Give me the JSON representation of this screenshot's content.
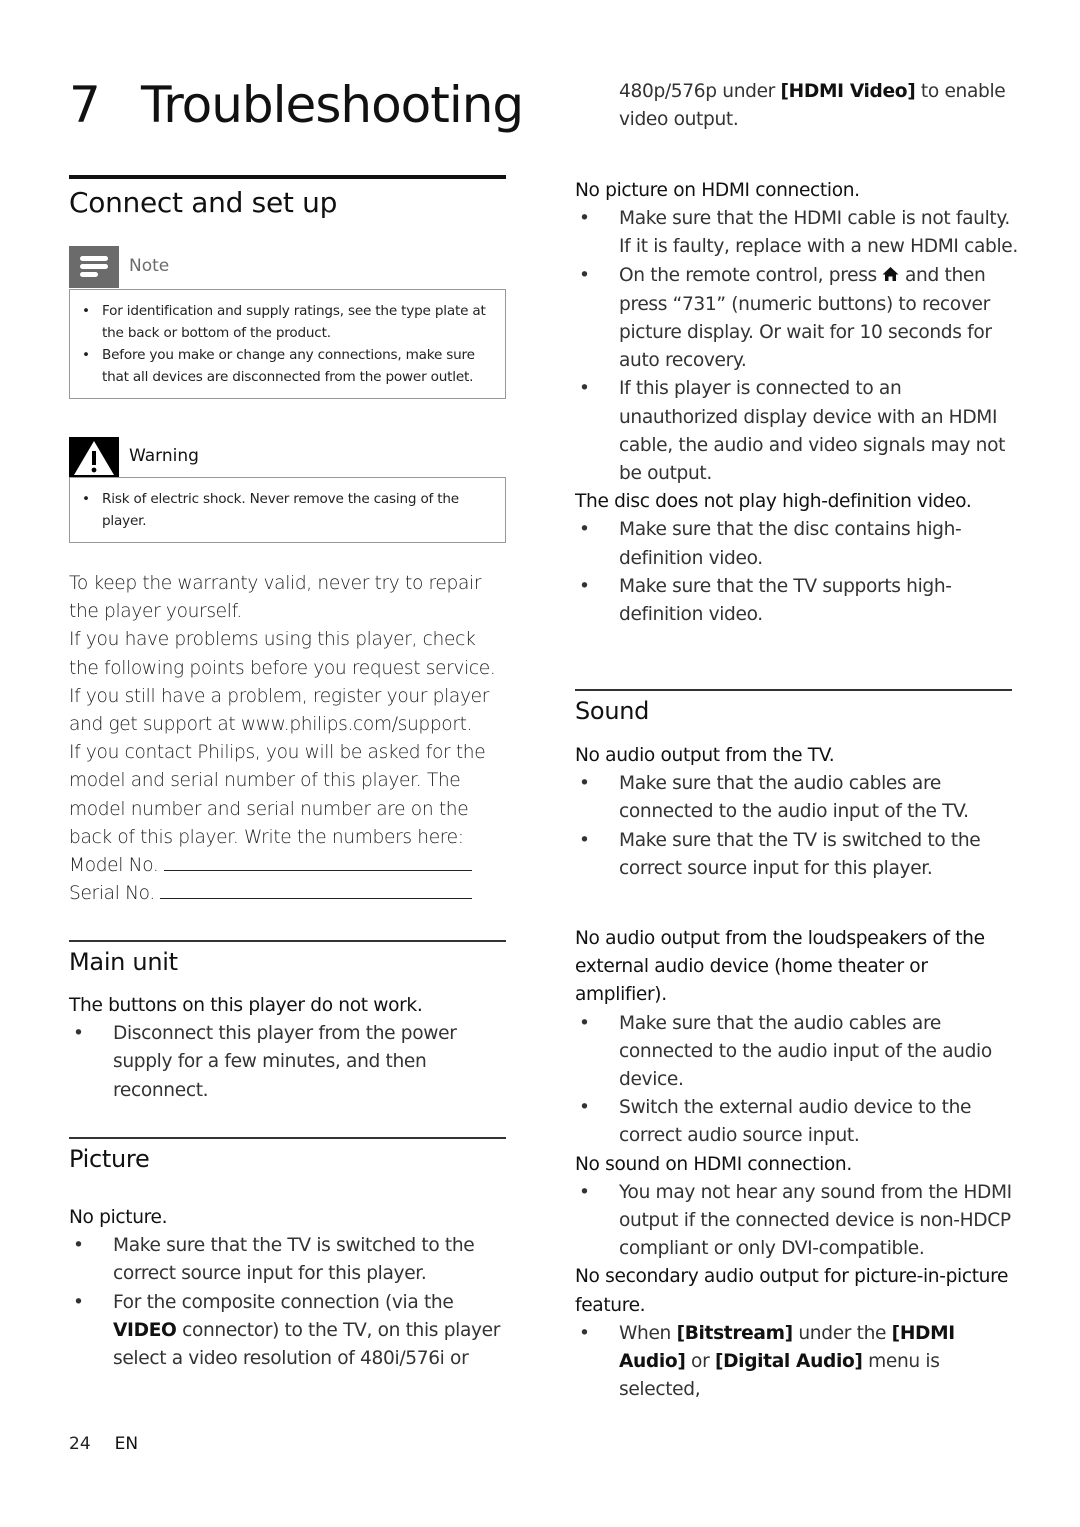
{
  "chapter": {
    "number": "7",
    "title": "Troubleshooting"
  },
  "left": {
    "section_title": "Connect and set up",
    "note": {
      "label": "Note",
      "icon": "note-icon",
      "items": [
        "For identification and supply ratings, see the type plate at the back or bottom of the product.",
        "Before you make or change any connections, make sure that all devices are disconnected from the power outlet."
      ]
    },
    "warning": {
      "label": "Warning",
      "icon": "warning-triangle-icon",
      "items": [
        "Risk of electric shock. Never remove the casing of the player."
      ]
    },
    "intro_paragraphs": [
      "To keep the warranty valid, never try to repair the player yourself.",
      "If you have problems using this player, check the following points before you request service. If you still have a problem, register your player and get support at www.philips.com/support.",
      "If you contact Philips, you will be asked for the model and serial number of this player. The model number and serial number are on the back of this player. Write the numbers here:"
    ],
    "model_label": "Model No.",
    "model_value": "",
    "serial_label": "Serial No.",
    "serial_value": "",
    "main_unit": {
      "title": "Main unit",
      "issue": "The buttons on this player do not work.",
      "items": [
        "Disconnect this player from the power supply for a few minutes, and then reconnect."
      ]
    },
    "picture": {
      "title": "Picture",
      "issue": "No picture.",
      "item1": "Make sure that the TV is switched to the correct source input for this player.",
      "item2_pre": "For the composite connection (via the ",
      "item2_bold": "VIDEO",
      "item2_post": " connector) to the TV, on this player select a video resolution of 480i/576i or"
    }
  },
  "right": {
    "cont_pre": "480p/576p under ",
    "cont_bold": "[HDMI Video]",
    "cont_post": " to enable video output.",
    "hdmi_picture": {
      "issue": "No picture on HDMI connection.",
      "item1": "Make sure that the HDMI cable is not faulty. If it is faulty, replace with a new HDMI cable.",
      "item2_pre": "On the remote control, press ",
      "item2_icon": "home-icon",
      "item2_post": " and then press “731” (numeric buttons) to recover picture display. Or wait for 10 seconds for auto recovery.",
      "item3": "If this player is connected to an unauthorized display device with an HDMI cable, the audio and video signals may not be output."
    },
    "hd_video": {
      "issue": "The disc does not play high-definition video.",
      "items": [
        "Make sure that the disc contains high-definition video.",
        "Make sure that the TV supports high-definition video."
      ]
    },
    "sound": {
      "title": "Sound",
      "tv_issue": "No audio output from the TV.",
      "tv_items": [
        "Make sure that the audio cables are connected to the audio input of the TV.",
        "Make sure that the TV is switched to the correct source input for this player."
      ],
      "ext_issue": "No audio output from the loudspeakers of the external audio device (home theater or amplifier).",
      "ext_items": [
        "Make sure that the audio cables are connected to the audio input of the audio device.",
        "Switch the external audio device to the correct audio source input."
      ],
      "hdmi_issue": "No sound on HDMI connection.",
      "hdmi_items": [
        "You may not hear any sound from the HDMI output if the connected device is non-HDCP compliant or only DVI-compatible."
      ],
      "pip_issue": "No secondary audio output for picture-in-picture feature.",
      "pip_item_pre": "When ",
      "pip_item_b1": "[Bitstream]",
      "pip_item_mid1": " under the ",
      "pip_item_b2": "[HDMI Audio]",
      "pip_item_mid2": " or ",
      "pip_item_b3": "[Digital Audio]",
      "pip_item_post": " menu is selected,"
    }
  },
  "footer": {
    "page_number": "24",
    "language": "EN"
  }
}
